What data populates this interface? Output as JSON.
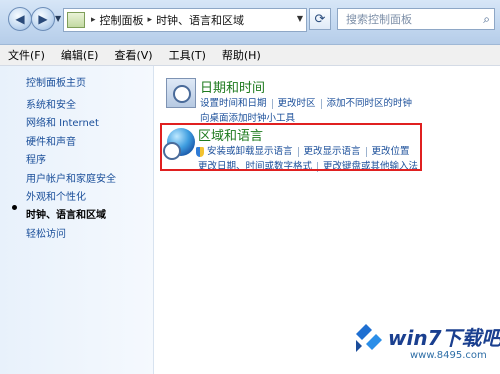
{
  "nav": {
    "back_arrow": "◀",
    "forward_arrow": "▶"
  },
  "address": {
    "crumbs": [
      "控制面板",
      "时钟、语言和区域"
    ],
    "separator": "▸"
  },
  "search": {
    "placeholder": "搜索控制面板"
  },
  "window_title_fragment": "时钟、语言和区域",
  "menu": [
    "文件(F)",
    "编辑(E)",
    "查看(V)",
    "工具(T)",
    "帮助(H)"
  ],
  "sidebar": {
    "home": "控制面板主页",
    "items": [
      {
        "label": "系统和安全",
        "current": false
      },
      {
        "label": "网络和 Internet",
        "current": false
      },
      {
        "label": "硬件和声音",
        "current": false
      },
      {
        "label": "程序",
        "current": false
      },
      {
        "label": "用户帐户和家庭安全",
        "current": false
      },
      {
        "label": "外观和个性化",
        "current": false
      },
      {
        "label": "时钟、语言和区域",
        "current": true
      },
      {
        "label": "轻松访问",
        "current": false
      }
    ]
  },
  "categories": {
    "datetime": {
      "title": "日期和时间",
      "links_row1": [
        "设置时间和日期",
        "更改时区",
        "添加不同时区的时钟"
      ],
      "links_row2": [
        "向桌面添加时钟小工具"
      ]
    },
    "region": {
      "title": "区域和语言",
      "links_row1": [
        "安装或卸载显示语言",
        "更改显示语言",
        "更改位置"
      ],
      "links_row2": [
        "更改日期、时间或数字格式",
        "更改键盘或其他输入法"
      ]
    }
  },
  "colors": {
    "highlight_box": "#e02020",
    "category_title": "#1e7a1e",
    "link": "#1b4f9a"
  },
  "watermark": {
    "brand": "win7下载吧",
    "url": "www.8495.com"
  }
}
